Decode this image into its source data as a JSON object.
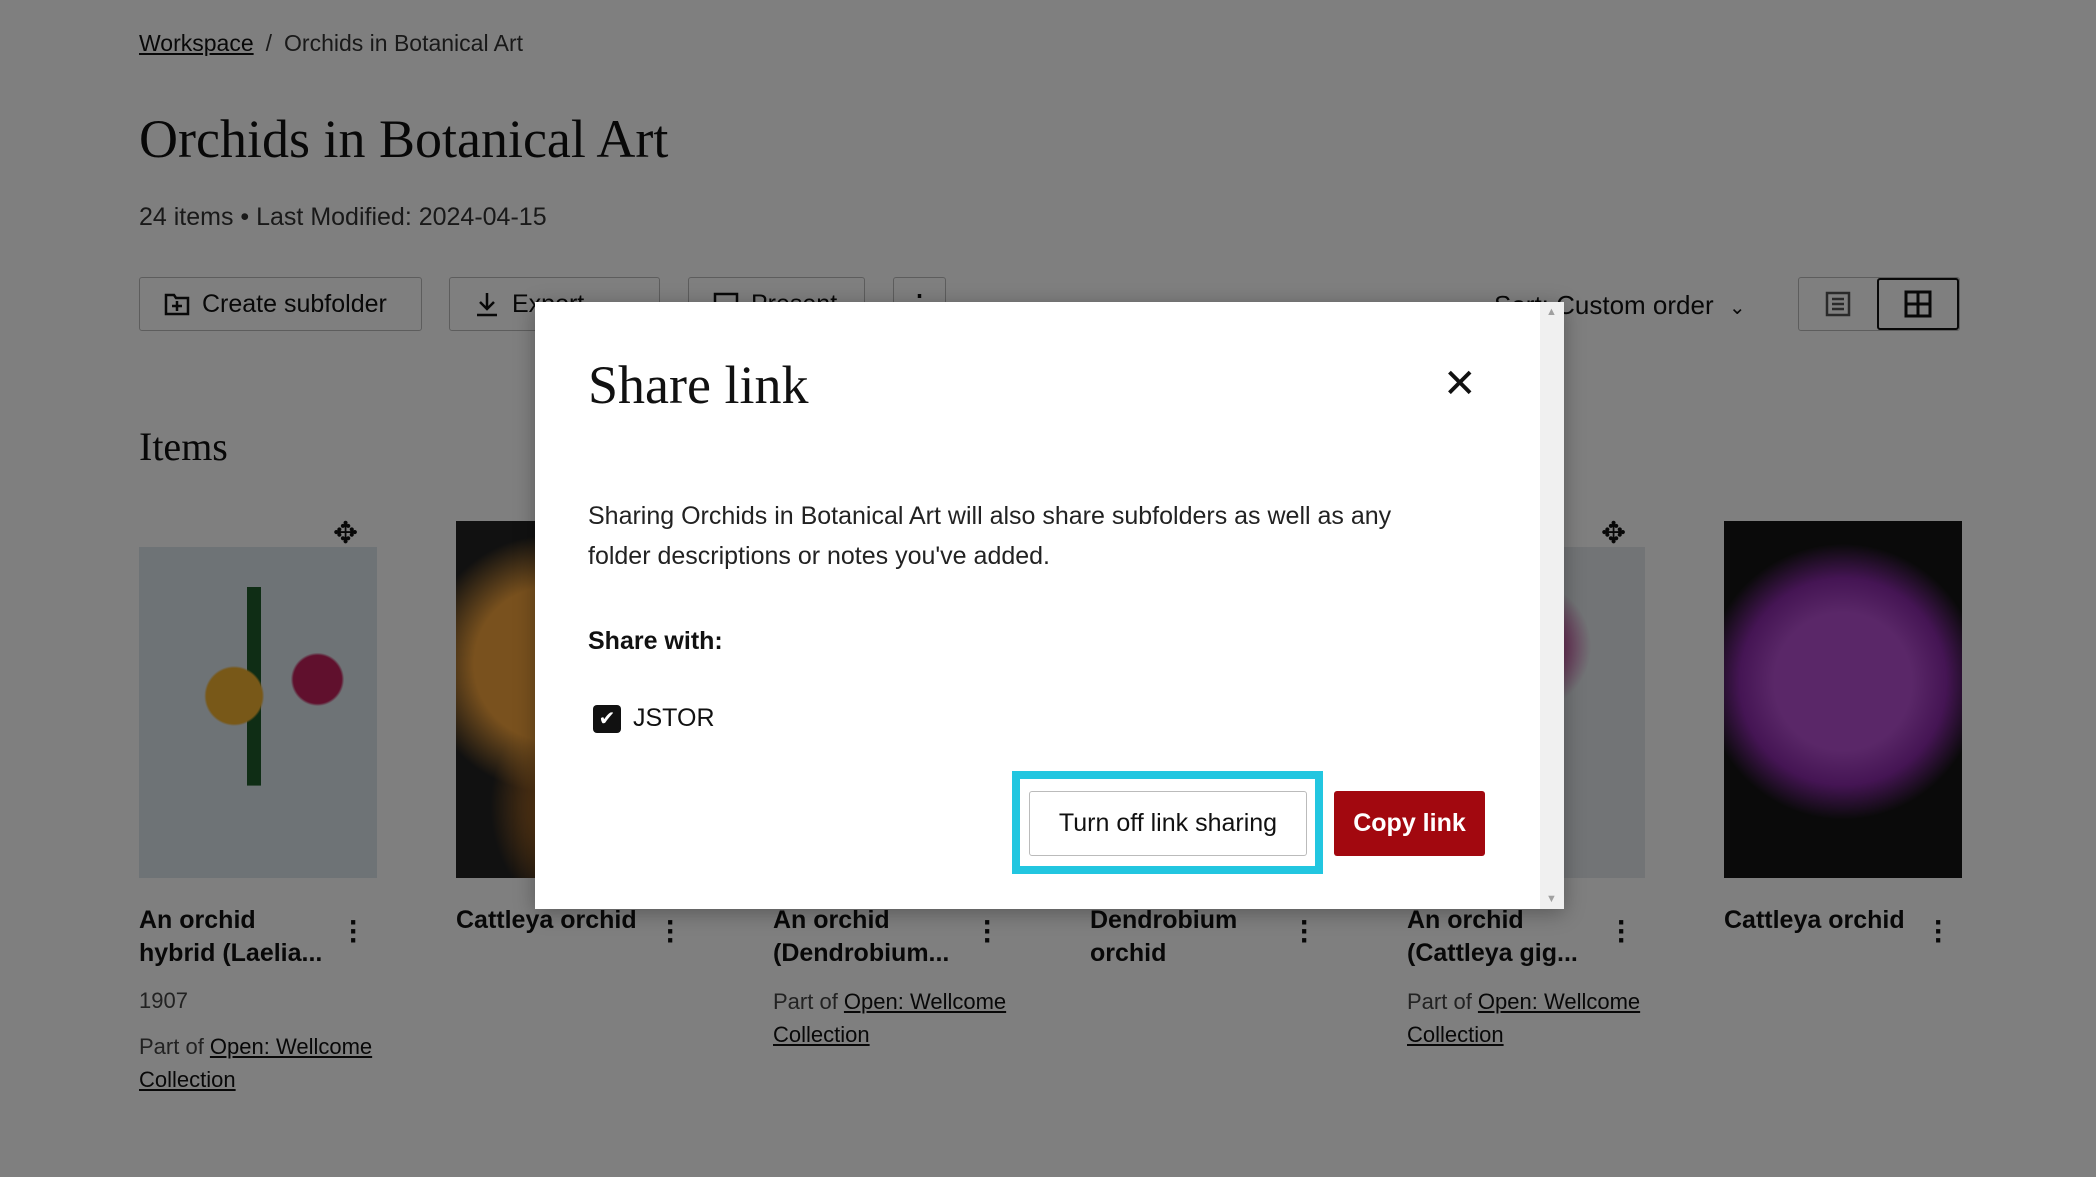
{
  "breadcrumb": {
    "root": "Workspace",
    "separator": "/",
    "current": "Orchids in Botanical Art"
  },
  "header": {
    "title": "Orchids in Botanical Art",
    "meta": "24 items • Last Modified: 2024-04-15"
  },
  "toolbar": {
    "create_subfolder": "Create subfolder",
    "export": "Export",
    "present": "Present",
    "more": "⋮",
    "sort": "Sort: Custom order",
    "views": [
      "list-view",
      "grid-view"
    ],
    "active_view": "grid-view"
  },
  "items_heading": "Items",
  "items": [
    {
      "title_line1": "An orchid",
      "title_line2": "hybrid (Laelia...",
      "date": "1907",
      "part_of": "Part of ",
      "collection_line1": "Open: Wellcome",
      "collection_line2": "Collection"
    },
    {
      "title_line1": "Cattleya orchid",
      "title_line2": ""
    },
    {
      "title_line1": "An orchid",
      "title_line2": "(Dendrobium...",
      "part_of": "Part of ",
      "collection_line1": "Open: Wellcome",
      "collection_line2": "Collection"
    },
    {
      "title_line1": "Dendrobium",
      "title_line2": "orchid"
    },
    {
      "title_line1": "An orchid",
      "title_line2": "(Cattleya gig...",
      "part_of": "Part of ",
      "collection_line1": "Open: Wellcome",
      "collection_line2": "Collection"
    },
    {
      "title_line1": "Cattleya orchid",
      "title_line2": ""
    }
  ],
  "modal": {
    "title": "Share link",
    "body": "Sharing Orchids in Botanical Art will also share subfolders as well as any folder descriptions or notes you've added.",
    "share_with_label": "Share with:",
    "checkbox_label": "JSTOR",
    "checkbox_checked": true,
    "turn_off_label": "Turn off link sharing",
    "copy_label": "Copy link",
    "accent": "#a2080f",
    "focus_color": "#22c6e0"
  }
}
